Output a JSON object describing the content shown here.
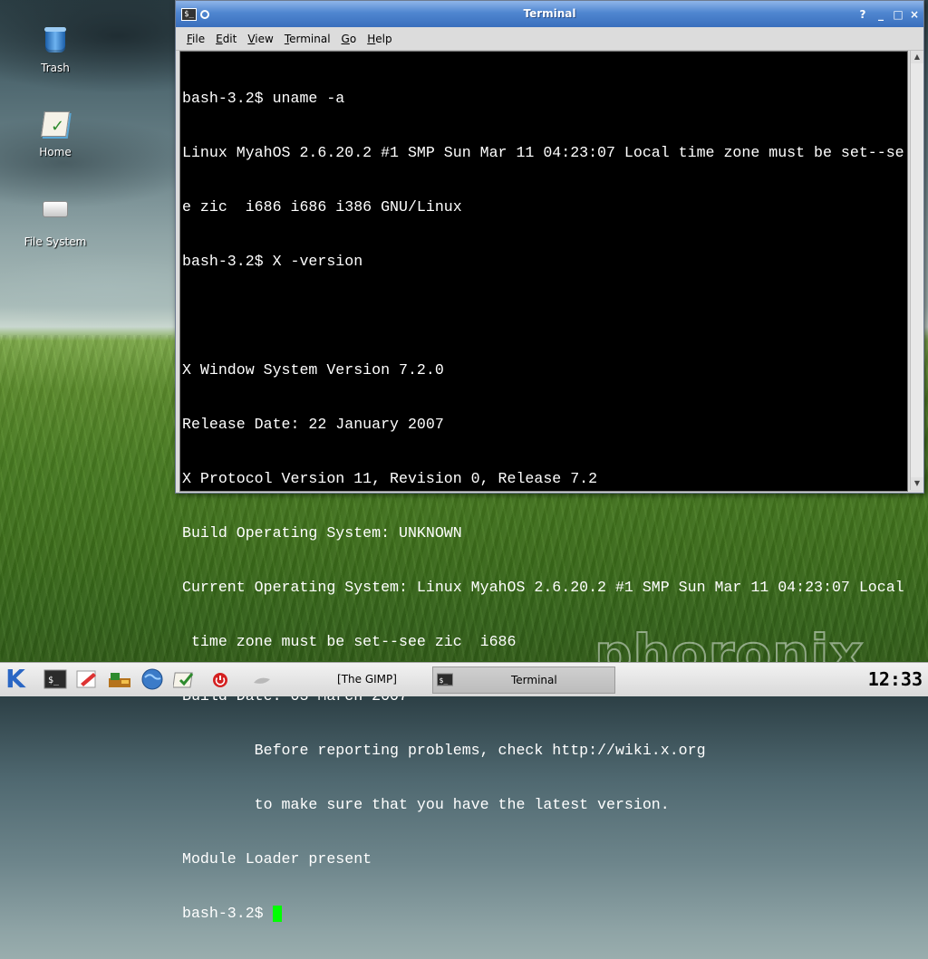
{
  "desktop": {
    "icons": [
      {
        "label": "Trash",
        "icon": "trash-icon"
      },
      {
        "label": "Home",
        "icon": "home-icon"
      },
      {
        "label": "File System",
        "icon": "drive-icon"
      }
    ],
    "watermark": "phoronix"
  },
  "window": {
    "title": "Terminal",
    "menu": [
      {
        "label": "File",
        "mnemonic": "F",
        "rest": "ile"
      },
      {
        "label": "Edit",
        "mnemonic": "E",
        "rest": "dit"
      },
      {
        "label": "View",
        "mnemonic": "V",
        "rest": "iew"
      },
      {
        "label": "Terminal",
        "mnemonic": "T",
        "rest": "erminal"
      },
      {
        "label": "Go",
        "mnemonic": "G",
        "rest": "o"
      },
      {
        "label": "Help",
        "mnemonic": "H",
        "rest": "elp"
      }
    ],
    "buttons": {
      "help": "?",
      "minimize": "_",
      "maximize": "□",
      "close": "×"
    },
    "terminal_lines": [
      "bash-3.2$ uname -a",
      "Linux MyahOS 2.6.20.2 #1 SMP Sun Mar 11 04:23:07 Local time zone must be set--se",
      "e zic  i686 i686 i386 GNU/Linux",
      "bash-3.2$ X -version",
      "",
      "X Window System Version 7.2.0",
      "Release Date: 22 January 2007",
      "X Protocol Version 11, Revision 0, Release 7.2",
      "Build Operating System: UNKNOWN",
      "Current Operating System: Linux MyahOS 2.6.20.2 #1 SMP Sun Mar 11 04:23:07 Local",
      " time zone must be set--see zic  i686",
      "Build Date: 03 March 2007",
      "        Before reporting problems, check http://wiki.x.org",
      "        to make sure that you have the latest version.",
      "Module Loader present"
    ],
    "prompt": "bash-3.2$ ",
    "cursor_color": "#00ff00"
  },
  "taskbar": {
    "launcher_label": "K",
    "tasks": [
      {
        "label": "[The GIMP]",
        "active": false
      },
      {
        "label": "Terminal",
        "active": true
      }
    ],
    "clock": "12:33"
  }
}
